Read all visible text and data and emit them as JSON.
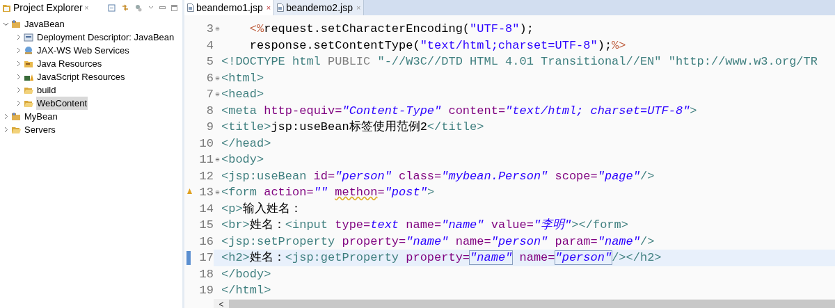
{
  "explorer": {
    "title": "Project Explorer",
    "close": "×",
    "tree": [
      {
        "label": "JavaBean",
        "kind": "project",
        "expanded": true,
        "selected": false,
        "children": [
          {
            "label": "Deployment Descriptor: JavaBean",
            "kind": "descriptor",
            "expanded": false,
            "selected": false
          },
          {
            "label": "JAX-WS Web Services",
            "kind": "services",
            "expanded": false,
            "selected": false
          },
          {
            "label": "Java Resources",
            "kind": "java",
            "expanded": false,
            "selected": false
          },
          {
            "label": "JavaScript Resources",
            "kind": "script",
            "expanded": false,
            "selected": false
          },
          {
            "label": "build",
            "kind": "folder",
            "expanded": false,
            "selected": false
          },
          {
            "label": "WebContent",
            "kind": "folder",
            "expanded": false,
            "selected": true
          }
        ]
      },
      {
        "label": "MyBean",
        "kind": "project",
        "expanded": false,
        "selected": false
      },
      {
        "label": "Servers",
        "kind": "folder",
        "expanded": false,
        "selected": false
      }
    ]
  },
  "tabs": [
    {
      "label": "beandemo1.jsp",
      "selected": true,
      "close": "×"
    },
    {
      "label": "beandemo2.jsp",
      "selected": false,
      "close": "×"
    }
  ],
  "lines": [
    {
      "number": "3",
      "fold": true,
      "current": false,
      "warning": false,
      "tokens": [
        {
          "kind": "jsp",
          "text": "    <%"
        },
        {
          "kind": "text",
          "text": "request.setCharacterEncoding("
        },
        {
          "kind": "jstring",
          "text": "\"UTF-8\""
        },
        {
          "kind": "text",
          "text": ");"
        }
      ]
    },
    {
      "number": "4",
      "fold": false,
      "current": false,
      "warning": false,
      "tokens": [
        {
          "kind": "text",
          "text": "    response.setContentType("
        },
        {
          "kind": "jstring",
          "text": "\"text/html;charset=UTF-8\""
        },
        {
          "kind": "text",
          "text": ");"
        },
        {
          "kind": "jsp",
          "text": "%>"
        }
      ]
    },
    {
      "number": "5",
      "fold": false,
      "current": false,
      "warning": false,
      "tokens": [
        {
          "kind": "tag",
          "text": "<!DOCTYPE html"
        },
        {
          "kind": "gray",
          "text": " PUBLIC "
        },
        {
          "kind": "dtstring",
          "text": "\"-//W3C//DTD HTML 4.01 Transitional//EN\" \"http://www.w3.org/TR"
        }
      ]
    },
    {
      "number": "6",
      "fold": true,
      "current": false,
      "warning": false,
      "tokens": [
        {
          "kind": "tag",
          "text": "<html>"
        }
      ]
    },
    {
      "number": "7",
      "fold": true,
      "current": false,
      "warning": false,
      "tokens": [
        {
          "kind": "tag",
          "text": "<head>"
        }
      ]
    },
    {
      "number": "8",
      "fold": false,
      "current": false,
      "warning": false,
      "tokens": [
        {
          "kind": "tag",
          "text": "<meta"
        },
        {
          "kind": "attr",
          "text": " http-equiv="
        },
        {
          "kind": "value",
          "text": "\"Content-Type\""
        },
        {
          "kind": "attr",
          "text": " content="
        },
        {
          "kind": "value",
          "text": "\"text/html; charset=UTF-8\""
        },
        {
          "kind": "tag",
          "text": ">"
        }
      ]
    },
    {
      "number": "9",
      "fold": false,
      "current": false,
      "warning": false,
      "tokens": [
        {
          "kind": "tag",
          "text": "<title>"
        },
        {
          "kind": "text",
          "text": "jsp:useBean标签使用范例2"
        },
        {
          "kind": "tag",
          "text": "</title>"
        }
      ]
    },
    {
      "number": "10",
      "fold": false,
      "current": false,
      "warning": false,
      "tokens": [
        {
          "kind": "tag",
          "text": "</head>"
        }
      ]
    },
    {
      "number": "11",
      "fold": true,
      "current": false,
      "warning": false,
      "tokens": [
        {
          "kind": "tag",
          "text": "<body>"
        }
      ]
    },
    {
      "number": "12",
      "fold": false,
      "current": false,
      "warning": false,
      "tokens": [
        {
          "kind": "tag",
          "text": "<jsp:useBean"
        },
        {
          "kind": "attr",
          "text": " id="
        },
        {
          "kind": "value",
          "text": "\"person\""
        },
        {
          "kind": "attr",
          "text": " class="
        },
        {
          "kind": "value",
          "text": "\"mybean.Person\""
        },
        {
          "kind": "attr",
          "text": " scope="
        },
        {
          "kind": "value",
          "text": "\"page\""
        },
        {
          "kind": "tag",
          "text": "/>"
        }
      ]
    },
    {
      "number": "13",
      "fold": true,
      "current": false,
      "warning": true,
      "tokens": [
        {
          "kind": "tag",
          "text": "<form"
        },
        {
          "kind": "attr",
          "text": " action="
        },
        {
          "kind": "value",
          "text": "\"\" "
        },
        {
          "kind": "attr",
          "text": "methon",
          "squiggle": true
        },
        {
          "kind": "attr",
          "text": "="
        },
        {
          "kind": "value",
          "text": "\"post\""
        },
        {
          "kind": "tag",
          "text": ">"
        }
      ]
    },
    {
      "number": "14",
      "fold": false,
      "current": false,
      "warning": false,
      "tokens": [
        {
          "kind": "tag",
          "text": "<p>"
        },
        {
          "kind": "text",
          "text": "输入姓名："
        }
      ]
    },
    {
      "number": "15",
      "fold": false,
      "current": false,
      "warning": false,
      "tokens": [
        {
          "kind": "tag",
          "text": "<br>"
        },
        {
          "kind": "text",
          "text": "姓名："
        },
        {
          "kind": "tag",
          "text": "<input"
        },
        {
          "kind": "attr",
          "text": " type="
        },
        {
          "kind": "value",
          "text": "text"
        },
        {
          "kind": "attr",
          "text": " name="
        },
        {
          "kind": "value",
          "text": "\"name\""
        },
        {
          "kind": "attr",
          "text": " value="
        },
        {
          "kind": "value",
          "text": "\"李明\""
        },
        {
          "kind": "tag",
          "text": "></form>"
        }
      ]
    },
    {
      "number": "16",
      "fold": false,
      "current": false,
      "warning": false,
      "tokens": [
        {
          "kind": "tag",
          "text": "<jsp:setProperty"
        },
        {
          "kind": "attr",
          "text": " property="
        },
        {
          "kind": "value",
          "text": "\"name\""
        },
        {
          "kind": "attr",
          "text": " name="
        },
        {
          "kind": "value",
          "text": "\"person\""
        },
        {
          "kind": "attr",
          "text": " param="
        },
        {
          "kind": "value",
          "text": "\"name\""
        },
        {
          "kind": "tag",
          "text": "/>"
        }
      ]
    },
    {
      "number": "17",
      "fold": false,
      "current": true,
      "warning": false,
      "tokens": [
        {
          "kind": "tag",
          "text": "<h2>"
        },
        {
          "kind": "text",
          "text": "姓名："
        },
        {
          "kind": "tag",
          "text": "<jsp:getProperty"
        },
        {
          "kind": "attr",
          "text": " property="
        },
        {
          "kind": "value",
          "text": "\"name\"",
          "boxed": true
        },
        {
          "kind": "attr",
          "text": " name="
        },
        {
          "kind": "value",
          "text": "\"person\"",
          "boxed": true
        },
        {
          "kind": "tag",
          "text": "/></h2>"
        }
      ]
    },
    {
      "number": "18",
      "fold": false,
      "current": false,
      "warning": false,
      "tokens": [
        {
          "kind": "tag",
          "text": "</body>"
        }
      ]
    },
    {
      "number": "19",
      "fold": false,
      "current": false,
      "warning": false,
      "tokens": [
        {
          "kind": "tag",
          "text": "</html>"
        }
      ]
    }
  ],
  "scrollbar": {
    "left_arrow": "<"
  }
}
